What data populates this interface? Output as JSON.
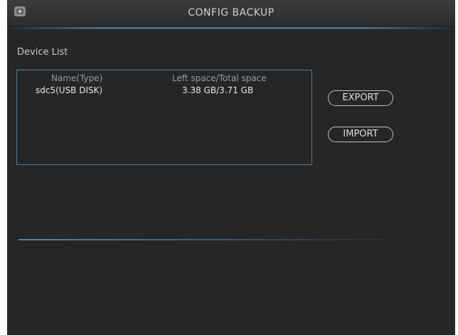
{
  "window": {
    "title": "CONFIG BACKUP",
    "icon": "app-logo-icon",
    "accent_color": "#4d7fa8"
  },
  "device_list": {
    "label": "Device List",
    "columns": [
      "Name(Type)",
      "Left space/Total space"
    ],
    "rows": [
      {
        "name": "sdc5(USB DISK)",
        "space": "3.38 GB/3.71 GB"
      }
    ]
  },
  "actions": {
    "export_label": "EXPORT",
    "import_label": "IMPORT"
  }
}
